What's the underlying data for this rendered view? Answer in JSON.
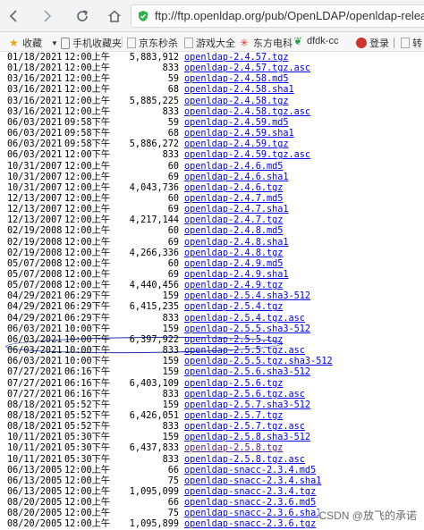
{
  "browser": {
    "url": "ftp://ftp.openldap.org/pub/OpenLDAP/openldap-relea",
    "bookmarks": [
      {
        "label": "收藏",
        "icon": "star-icon"
      },
      {
        "label": "手机收藏夹",
        "icon": "phone-folder-icon"
      },
      {
        "label": "京东秒杀",
        "icon": "page-icon"
      },
      {
        "label": "游戏大全",
        "icon": "page-icon"
      },
      {
        "label": "东方电科",
        "icon": "sparkle-icon"
      },
      {
        "label": "dfdk-cc",
        "icon": "leaf-icon"
      },
      {
        "label": "登录｜",
        "icon": "shield-icon"
      },
      {
        "label": "转",
        "icon": "page-icon"
      }
    ]
  },
  "listing": [
    {
      "date": "01/18/2021",
      "time": "12:00上午",
      "size": "5,883,912",
      "name": "openldap-2.4.57.tgz"
    },
    {
      "date": "01/18/2021",
      "time": "12:00上午",
      "size": "833",
      "name": "openldap-2.4.57.tgz.asc"
    },
    {
      "date": "03/16/2021",
      "time": "12:00上午",
      "size": "59",
      "name": "openldap-2.4.58.md5"
    },
    {
      "date": "03/16/2021",
      "time": "12:00上午",
      "size": "68",
      "name": "openldap-2.4.58.sha1"
    },
    {
      "date": "03/16/2021",
      "time": "12:00上午",
      "size": "5,885,225",
      "name": "openldap-2.4.58.tgz"
    },
    {
      "date": "03/16/2021",
      "time": "12:00上午",
      "size": "833",
      "name": "openldap-2.4.58.tgz.asc"
    },
    {
      "date": "06/03/2021",
      "time": "09:58下午",
      "size": "59",
      "name": "openldap-2.4.59.md5"
    },
    {
      "date": "06/03/2021",
      "time": "09:58下午",
      "size": "68",
      "name": "openldap-2.4.59.sha1"
    },
    {
      "date": "06/03/2021",
      "time": "09:58下午",
      "size": "5,886,272",
      "name": "openldap-2.4.59.tgz"
    },
    {
      "date": "06/03/2021",
      "time": "12:00下午",
      "size": "833",
      "name": "openldap-2.4.59.tgz.asc"
    },
    {
      "date": "10/31/2007",
      "time": "12:00上午",
      "size": "60",
      "name": "openldap-2.4.6.md5"
    },
    {
      "date": "10/31/2007",
      "time": "12:00上午",
      "size": "69",
      "name": "openldap-2.4.6.sha1"
    },
    {
      "date": "10/31/2007",
      "time": "12:00上午",
      "size": "4,043,736",
      "name": "openldap-2.4.6.tgz"
    },
    {
      "date": "12/13/2007",
      "time": "12:00上午",
      "size": "60",
      "name": "openldap-2.4.7.md5"
    },
    {
      "date": "12/13/2007",
      "time": "12:00上午",
      "size": "69",
      "name": "openldap-2.4.7.sha1"
    },
    {
      "date": "12/13/2007",
      "time": "12:00上午",
      "size": "4,217,144",
      "name": "openldap-2.4.7.tgz"
    },
    {
      "date": "02/19/2008",
      "time": "12:00上午",
      "size": "60",
      "name": "openldap-2.4.8.md5"
    },
    {
      "date": "02/19/2008",
      "time": "12:00上午",
      "size": "69",
      "name": "openldap-2.4.8.sha1"
    },
    {
      "date": "02/19/2008",
      "time": "12:00上午",
      "size": "4,266,336",
      "name": "openldap-2.4.8.tgz"
    },
    {
      "date": "05/07/2008",
      "time": "12:00上午",
      "size": "60",
      "name": "openldap-2.4.9.md5"
    },
    {
      "date": "05/07/2008",
      "time": "12:00上午",
      "size": "69",
      "name": "openldap-2.4.9.sha1"
    },
    {
      "date": "05/07/2008",
      "time": "12:00上午",
      "size": "4,440,456",
      "name": "openldap-2.4.9.tgz"
    },
    {
      "date": "04/29/2021",
      "time": "06:29下午",
      "size": "159",
      "name": "openldap-2.5.4.sha3-512"
    },
    {
      "date": "04/29/2021",
      "time": "06:29下午",
      "size": "6,415,235",
      "name": "openldap-2.5.4.tgz"
    },
    {
      "date": "04/29/2021",
      "time": "06:29下午",
      "size": "833",
      "name": "openldap-2.5.4.tgz.asc"
    },
    {
      "date": "06/03/2021",
      "time": "10:00下午",
      "size": "159",
      "name": "openldap-2.5.5.sha3-512"
    },
    {
      "date": "06/03/2021",
      "time": "10:00下午",
      "size": "6,397,922",
      "name": "openldap-2.5.5.tgz"
    },
    {
      "date": "06/03/2021",
      "time": "10:00下午",
      "size": "833",
      "name": "openldap-2.5.5.tgz.asc"
    },
    {
      "date": "06/03/2021",
      "time": "10:00下午",
      "size": "159",
      "name": "openldap-2.5.5.tgz.sha3-512"
    },
    {
      "date": "07/27/2021",
      "time": "06:16下午",
      "size": "159",
      "name": "openldap-2.5.6.sha3-512"
    },
    {
      "date": "07/27/2021",
      "time": "06:16下午",
      "size": "6,403,109",
      "name": "openldap-2.5.6.tgz"
    },
    {
      "date": "07/27/2021",
      "time": "06:16下午",
      "size": "833",
      "name": "openldap-2.5.6.tgz.asc"
    },
    {
      "date": "08/18/2021",
      "time": "05:52下午",
      "size": "159",
      "name": "openldap-2.5.7.sha3-512"
    },
    {
      "date": "08/18/2021",
      "time": "05:52下午",
      "size": "6,426,051",
      "name": "openldap-2.5.7.tgz"
    },
    {
      "date": "08/18/2021",
      "time": "05:52下午",
      "size": "833",
      "name": "openldap-2.5.7.tgz.asc"
    },
    {
      "date": "10/11/2021",
      "time": "05:30下午",
      "size": "159",
      "name": "openldap-2.5.8.sha3-512"
    },
    {
      "date": "10/11/2021",
      "time": "05:30下午",
      "size": "6,437,833",
      "name": "openldap-2.5.8.tgz",
      "visited": true
    },
    {
      "date": "10/11/2021",
      "time": "05:30下午",
      "size": "833",
      "name": "openldap-2.5.8.tgz.asc"
    },
    {
      "date": "06/13/2005",
      "time": "12:00上午",
      "size": "66",
      "name": "openldap-snacc-2.3.4.md5"
    },
    {
      "date": "06/13/2005",
      "time": "12:00上午",
      "size": "75",
      "name": "openldap-snacc-2.3.4.sha1"
    },
    {
      "date": "06/13/2005",
      "time": "12:00上午",
      "size": "1,095,099",
      "name": "openldap-snacc-2.3.4.tgz"
    },
    {
      "date": "08/20/2005",
      "time": "12:00上午",
      "size": "66",
      "name": "openldap-snacc-2.3.6.md5"
    },
    {
      "date": "08/20/2005",
      "time": "12:00上午",
      "size": "75",
      "name": "openldap-snacc-2.3.6.sha1"
    },
    {
      "date": "08/20/2005",
      "time": "12:00上午",
      "size": "1,095,899",
      "name": "openldap-snacc-2.3.6.tgz"
    }
  ],
  "highlighted_row": 26,
  "watermark": "CSDN @放飞的承诺",
  "colors": {
    "link": "#0000ee",
    "visited": "#551a8b",
    "oval": "#1d2ea6"
  }
}
